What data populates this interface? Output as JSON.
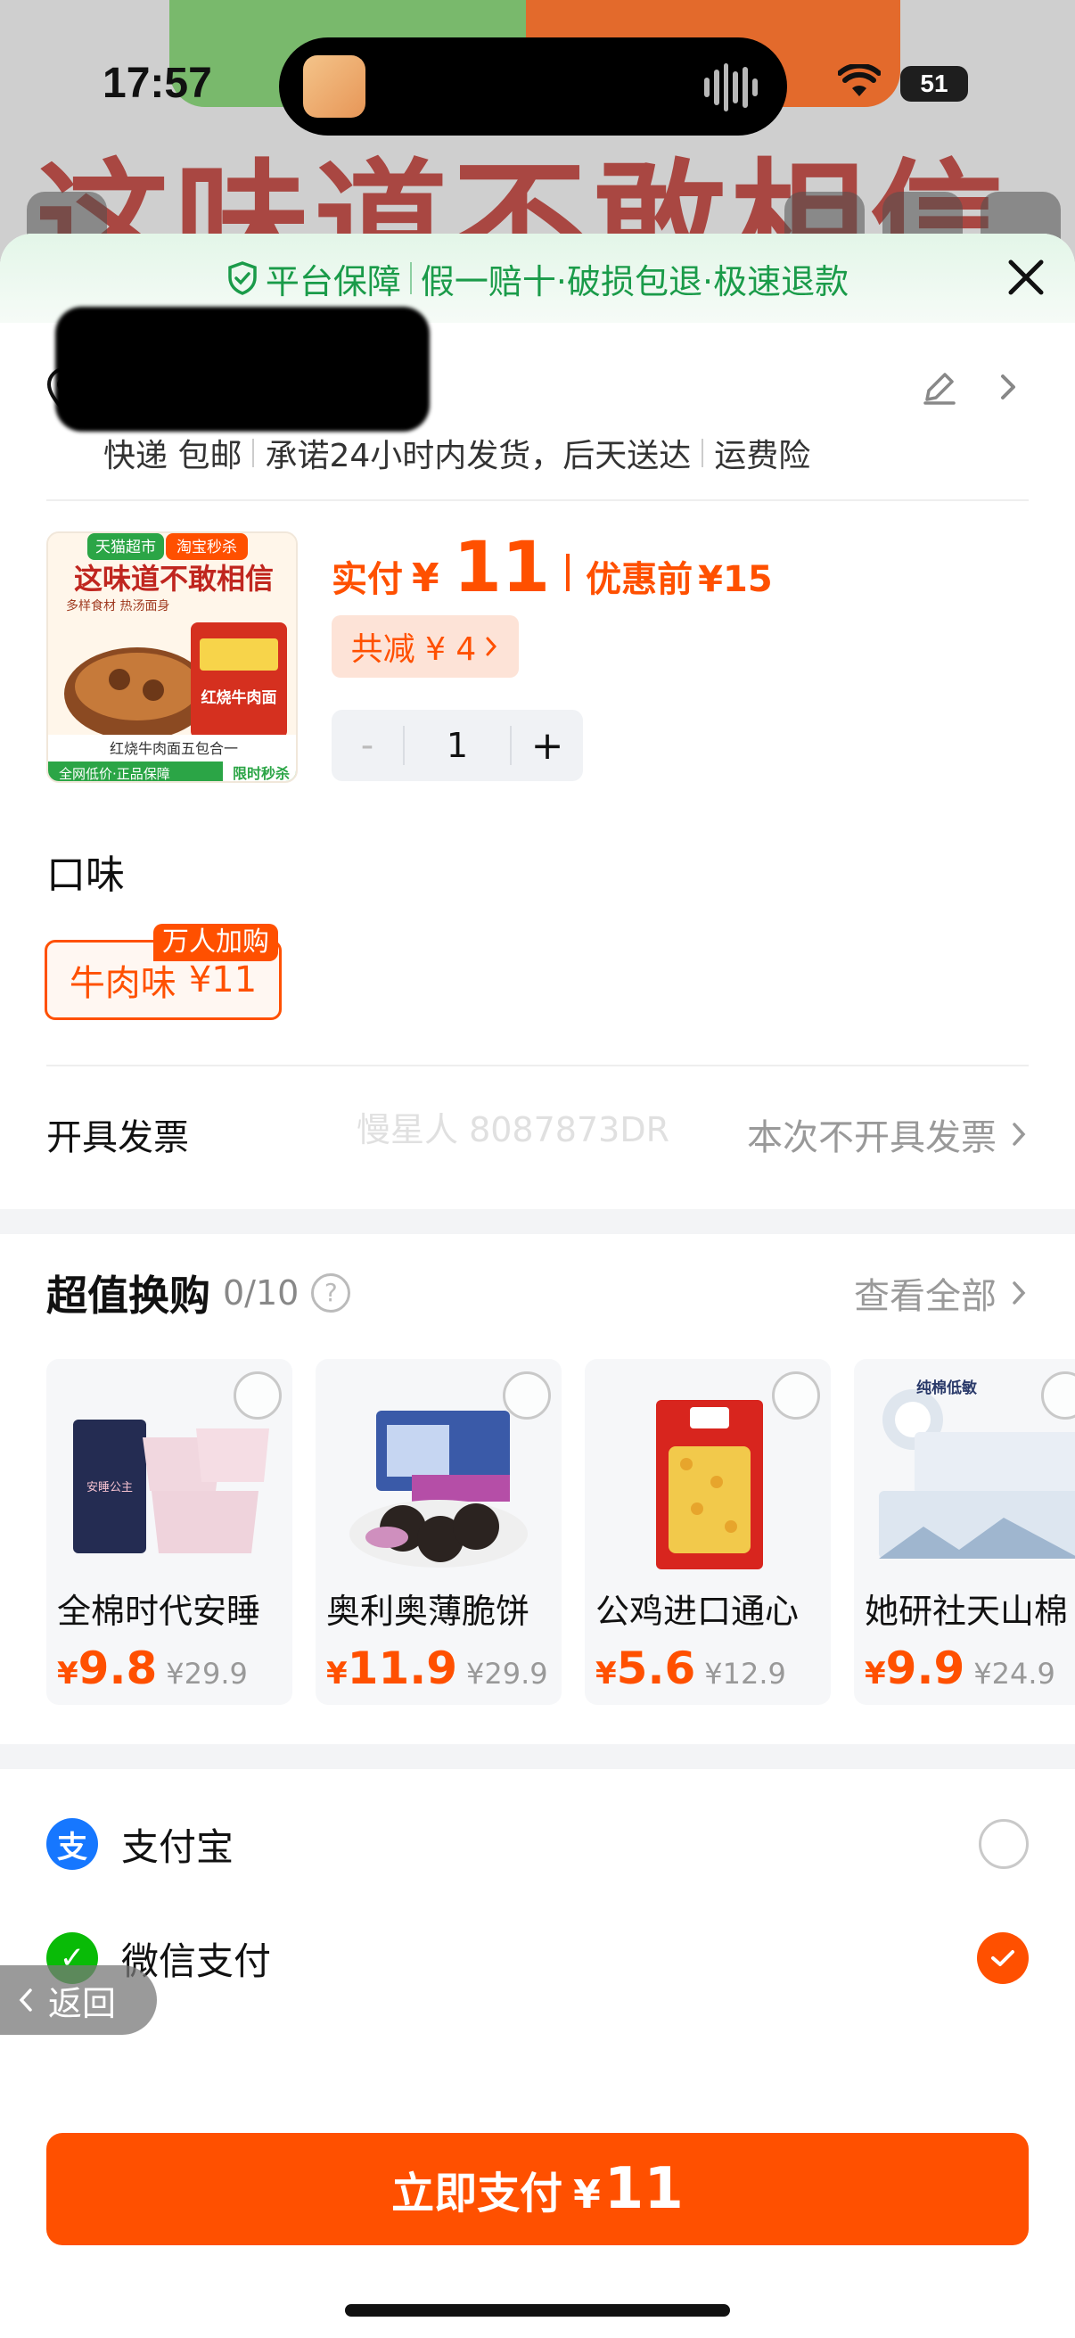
{
  "status_bar": {
    "time": "17:57",
    "battery": "51"
  },
  "background_page": {
    "tag_left": "天猫超市",
    "tag_right": "淘宝秒杀",
    "headline": "这味道不敢相信"
  },
  "guarantee": {
    "title": "平台保障",
    "items": "假一赔十·破损包退·极速退款",
    "colors": {
      "text": "#1a9b49"
    }
  },
  "address": {
    "shipping": [
      "快递 包邮",
      "承诺24小时内发货，后天送达",
      "运费险"
    ]
  },
  "product": {
    "image_headline": "这味道不敢相信",
    "image_tags": [
      "天猫超市",
      "淘宝秒杀"
    ],
    "image_sub": "多样食材 热汤面身",
    "image_flavor": "红烧牛肉面",
    "image_pack": "红烧牛肉面五包合一",
    "image_bottom_left": "全网低价·正品保障",
    "image_bottom_right": "限时秒杀",
    "price_label": "实付",
    "currency": "¥",
    "price": "11",
    "before_label": "优惠前",
    "before_price": "¥15",
    "discount": "共减 ¥ 4",
    "quantity": "1",
    "minus": "-",
    "plus": "+"
  },
  "flavor": {
    "title": "口味",
    "option_name": "牛肉味",
    "option_price": "¥11",
    "badge": "万人加购"
  },
  "invoice": {
    "label": "开具发票",
    "value": "本次不开具发票",
    "watermark": "慢星人 8087873DR"
  },
  "swap": {
    "title": "超值换购",
    "count": "0/10",
    "help": "?",
    "view_all": "查看全部",
    "items": [
      {
        "name": "全棉时代安睡",
        "price_int": "9.8",
        "was": "¥29.9",
        "color": "#e8e3ec"
      },
      {
        "name": "奥利奥薄脆饼",
        "price_int": "11.9",
        "was": "¥29.9",
        "color": "#e6e6ee"
      },
      {
        "name": "公鸡进口通心",
        "price_int": "5.6",
        "was": "¥12.9",
        "color": "#f3e6d8"
      },
      {
        "name": "她研社天山棉",
        "price_int": "9.9",
        "was": "¥24.9",
        "color": "#e8eef4",
        "tag": "纯棉低敏"
      }
    ]
  },
  "payment": {
    "methods": [
      {
        "name": "支付宝",
        "logo": "支",
        "color": "#1677ff",
        "selected": false
      },
      {
        "name": "微信支付",
        "logo": "✓",
        "color": "#09bb07",
        "selected": true
      }
    ]
  },
  "back_label": "返回",
  "pay_button": {
    "label": "立即支付",
    "currency": "¥",
    "amount": "11"
  }
}
